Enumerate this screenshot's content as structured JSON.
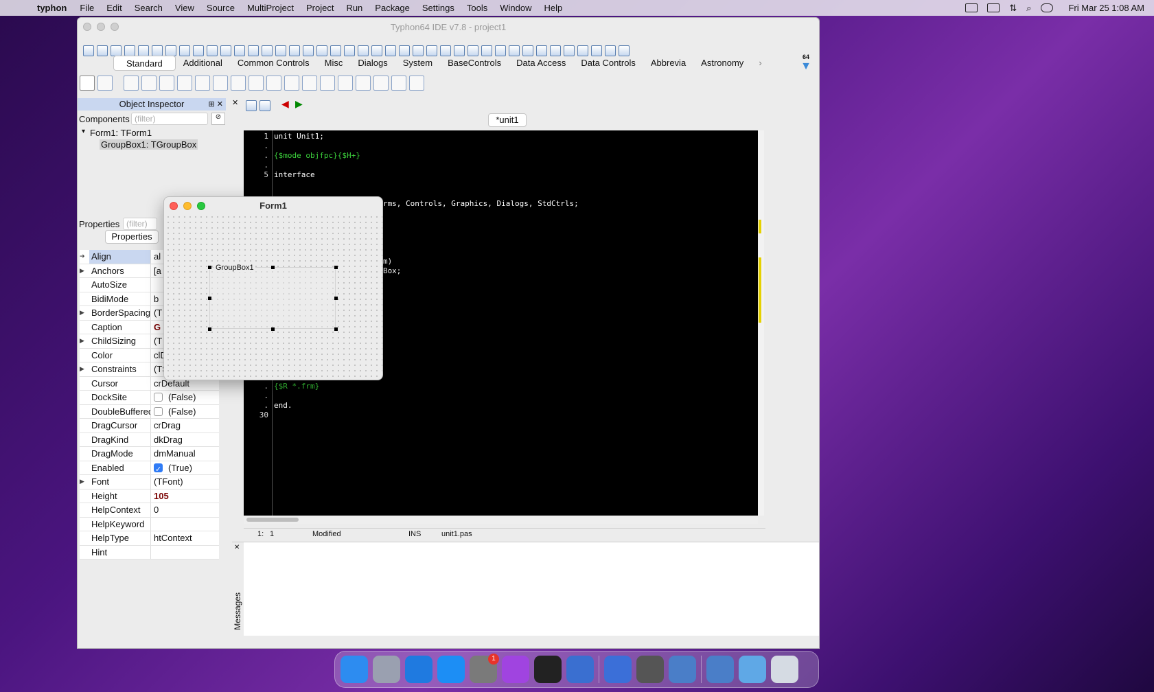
{
  "menubar": {
    "app_name": "typhon",
    "items": [
      "File",
      "Edit",
      "Search",
      "View",
      "Source",
      "MultiProject",
      "Project",
      "Run",
      "Package",
      "Settings",
      "Tools",
      "Window",
      "Help"
    ],
    "clock": "Fri Mar 25  1:08 AM"
  },
  "ide": {
    "title": "Typhon64 IDE v7.8 - project1",
    "side_badge": "64",
    "palette_tabs": [
      "Standard",
      "Additional",
      "Common Controls",
      "Misc",
      "Dialogs",
      "System",
      "BaseControls",
      "Data Access",
      "Data Controls",
      "Abbrevia",
      "Astronomy"
    ],
    "palette_components": [
      "TMainMenu",
      "TPopupMenu",
      "TButton",
      "TLabel",
      "TEdit",
      "TMemo",
      "TToggleBox",
      "TCheckBox",
      "TRadioButton",
      "TListBox",
      "TComboBox",
      "TScrollBar",
      "TGroupBox",
      "TRadioGroup",
      "TCheckGroup",
      "TPanel",
      "TFrame",
      "TActionList"
    ]
  },
  "inspector": {
    "title": "Object Inspector",
    "components_label": "Components",
    "filter_placeholder": "(filter)",
    "tree": [
      "Form1: TForm1",
      "GroupBox1: TGroupBox"
    ],
    "properties_label": "Properties",
    "properties_tab": "Properties",
    "properties": [
      {
        "name": "Align",
        "value": "al",
        "expand": false,
        "selected": true
      },
      {
        "name": "Anchors",
        "value": "[a",
        "expand": true
      },
      {
        "name": "AutoSize",
        "value": "",
        "expand": false
      },
      {
        "name": "BidiMode",
        "value": "b",
        "expand": false
      },
      {
        "name": "BorderSpacing",
        "value": "(T",
        "expand": true
      },
      {
        "name": "Caption",
        "value": "G",
        "expand": false,
        "bold": true
      },
      {
        "name": "ChildSizing",
        "value": "(T",
        "expand": true
      },
      {
        "name": "Color",
        "value": "clDefault",
        "expand": false
      },
      {
        "name": "Constraints",
        "value": "(TSizeConstraints",
        "expand": true
      },
      {
        "name": "Cursor",
        "value": "crDefault",
        "expand": false
      },
      {
        "name": "DockSite",
        "value": "(False)",
        "expand": false,
        "checkbox": "off"
      },
      {
        "name": "DoubleBuffered",
        "value": "(False)",
        "expand": false,
        "checkbox": "off"
      },
      {
        "name": "DragCursor",
        "value": "crDrag",
        "expand": false
      },
      {
        "name": "DragKind",
        "value": "dkDrag",
        "expand": false
      },
      {
        "name": "DragMode",
        "value": "dmManual",
        "expand": false
      },
      {
        "name": "Enabled",
        "value": "(True)",
        "expand": false,
        "checkbox": "on"
      },
      {
        "name": "Font",
        "value": "(TFont)",
        "expand": true
      },
      {
        "name": "Height",
        "value": "105",
        "expand": false,
        "bold": true
      },
      {
        "name": "HelpContext",
        "value": "0",
        "expand": false
      },
      {
        "name": "HelpKeyword",
        "value": "",
        "expand": false
      },
      {
        "name": "HelpType",
        "value": "htContext",
        "expand": false
      },
      {
        "name": "Hint",
        "value": "",
        "expand": false
      }
    ]
  },
  "editor": {
    "tab": "*unit1",
    "gutter": [
      {
        "n": "1",
        "line": 1
      },
      {
        "n": ".",
        "line": 2
      },
      {
        "n": ".",
        "line": 3
      },
      {
        "n": ".",
        "line": 4
      },
      {
        "n": "5",
        "line": 5
      },
      {
        "n": ".",
        "line": 22
      },
      {
        "n": ".",
        "line": 23
      },
      {
        "n": ".",
        "line": 24
      },
      {
        "n": "25",
        "line": 25
      },
      {
        "n": ".",
        "line": 26
      },
      {
        "n": ".",
        "line": 27
      },
      {
        "n": ".",
        "line": 28
      },
      {
        "n": ".",
        "line": 29
      },
      {
        "n": "30",
        "line": 30
      }
    ],
    "code": [
      {
        "line": 1,
        "text": "unit Unit1;",
        "color": "#ffffff"
      },
      {
        "line": 3,
        "text": "{$mode objfpc}{$H+}",
        "color": "#3cd23c"
      },
      {
        "line": 5,
        "text": "interface",
        "color": "#ffffff"
      },
      {
        "line": 8,
        "text": "                      Forms, Controls, Graphics, Dialogs, StdCtrls;",
        "color": "#ffffff"
      },
      {
        "line": 14,
        "text": "                      orm)",
        "color": "#ffffff"
      },
      {
        "line": 15,
        "text": "                      upBox;",
        "color": "#ffffff"
      },
      {
        "line": 25,
        "text": "implementation",
        "color": "#ffffff"
      },
      {
        "line": 27,
        "text": "{$R *.frm}",
        "color": "#3cd23c"
      },
      {
        "line": 29,
        "text": "end.",
        "color": "#ffffff"
      }
    ],
    "status": {
      "pos_line": "1:",
      "pos_col": "1",
      "state": "Modified",
      "mode": "INS",
      "file": "unit1.pas"
    }
  },
  "messages": {
    "label": "Messages"
  },
  "form1": {
    "title": "Form1",
    "groupbox_caption": "GroupBox1"
  },
  "dock": {
    "items": [
      "finder-icon",
      "launchpad-icon",
      "safari-icon",
      "app-store-icon",
      "system-preferences-icon",
      "feedback-icon",
      "terminal-icon",
      "typhon-icon",
      "xcode-icon",
      "x11-icon",
      "typhon2-icon",
      "typhon-ide-icon",
      "downloads-folder-icon",
      "trash-icon"
    ],
    "badge": "1"
  }
}
